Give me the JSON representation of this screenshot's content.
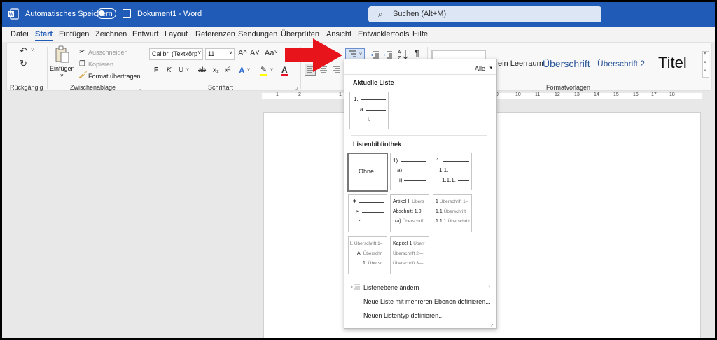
{
  "titlebar": {
    "autosave_label": "Automatisches Speichern",
    "doc_title": "Dokument1 - Word",
    "search_placeholder": "Suchen (Alt+M)"
  },
  "menu": [
    "Datei",
    "Start",
    "Einfügen",
    "Zeichnen",
    "Entwurf",
    "Layout",
    "Referenzen",
    "Sendungen",
    "Überprüfen",
    "Ansicht",
    "Entwicklertools",
    "Hilfe"
  ],
  "ribbon": {
    "undo_group": "Rückgängig",
    "clipboard": {
      "group": "Zwischenablage",
      "paste": "Einfügen",
      "cut": "Ausschneiden",
      "copy": "Kopieren",
      "format_painter": "Format übertragen"
    },
    "font": {
      "group": "Schriftart",
      "font_name": "Calibri (Textkörp",
      "font_size": "11",
      "grow": "A^",
      "shrink": "A˅",
      "case": "Aa",
      "bold": "F",
      "italic": "K",
      "underline": "U",
      "strike": "ab",
      "sub": "x₂",
      "sup": "x²"
    },
    "styles": {
      "group": "Formatvorlagen",
      "no_spacing": "ein Leerraum",
      "heading1": "Überschrift",
      "heading2": "Überschrift 2",
      "title": "Titel"
    },
    "paragraph": {
      "pilcrow": "¶"
    }
  },
  "ruler_labels": [
    "1",
    "2",
    "1",
    "2",
    "3",
    "4",
    "5",
    "6",
    "7",
    "8",
    "9",
    "10",
    "11",
    "12",
    "13",
    "14",
    "15",
    "16",
    "17",
    "18"
  ],
  "dropdown": {
    "filter": "Alle",
    "current_header": "Aktuelle Liste",
    "library_header": "Listenbibliothek",
    "none_label": "Ohne",
    "current_tile": [
      "1.",
      "a.",
      "i."
    ],
    "tile_num": [
      "1)",
      "a)",
      "i)"
    ],
    "tile_decimal": [
      "1.",
      "1.1.",
      "1.1.1."
    ],
    "tile_bullets": [
      "❖",
      "➢",
      "▪"
    ],
    "tile_artikel": [
      {
        "a": "Artikel I.",
        "b": "Übers"
      },
      {
        "a": "Abschnitt 1.0",
        "b": ""
      },
      {
        "a": "(a)",
        "b": "Überschrif"
      }
    ],
    "tile_heading_num": [
      {
        "a": "1",
        "b": "Überschrift 1–"
      },
      {
        "a": "1.1",
        "b": "Überschrift"
      },
      {
        "a": "1.1.1",
        "b": "Überschrift"
      }
    ],
    "tile_roman": [
      {
        "a": "I.",
        "b": "Überschrift 1–"
      },
      {
        "a": "A.",
        "b": "Überschri"
      },
      {
        "a": "1.",
        "b": "Übersc"
      }
    ],
    "tile_kapitel": [
      {
        "a": "Kapitel 1",
        "b": "Überr"
      },
      {
        "a": "",
        "b": "Überschrift 2—"
      },
      {
        "a": "",
        "b": "Überschrift 3—"
      }
    ],
    "change_level": "Listenebene ändern",
    "define_multilevel": "Neue Liste mit mehreren Ebenen definieren...",
    "define_style": "Neuen Listentyp definieren..."
  },
  "colors": {
    "title_bar": "#1f5bb7",
    "arrow": "#e8141c",
    "highlight": "#ffff00",
    "font_color": "#e81123"
  }
}
